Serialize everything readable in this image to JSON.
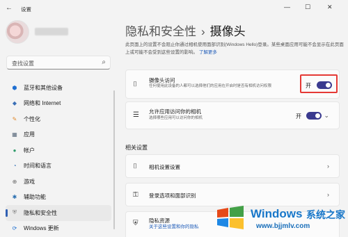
{
  "window": {
    "title": "设置",
    "back_icon": "back-arrow-icon",
    "controls": [
      "minimize-icon",
      "maximize-icon",
      "close-icon"
    ]
  },
  "sidebar": {
    "search_placeholder": "查找设置",
    "items": [
      {
        "label": "蓝牙和其他设备",
        "icon": "bluetooth-icon",
        "color": "#1f6fd1"
      },
      {
        "label": "网络和 Internet",
        "icon": "wifi-icon",
        "color": "#3b6fb6"
      },
      {
        "label": "个性化",
        "icon": "brush-icon",
        "color": "#e08a2e"
      },
      {
        "label": "应用",
        "icon": "apps-icon",
        "color": "#5b6b7d"
      },
      {
        "label": "帐户",
        "icon": "account-icon",
        "color": "#2e9b6a"
      },
      {
        "label": "时间和语言",
        "icon": "globe-clock-icon",
        "color": "#2f6fb3"
      },
      {
        "label": "游戏",
        "icon": "gamepad-icon",
        "color": "#6b6b6b"
      },
      {
        "label": "辅助功能",
        "icon": "accessibility-icon",
        "color": "#2a6fb0"
      },
      {
        "label": "隐私和安全性",
        "icon": "shield-icon",
        "color": "#7c7c7c",
        "active": true
      },
      {
        "label": "Windows 更新",
        "icon": "update-icon",
        "color": "#1f6fd1"
      }
    ]
  },
  "main": {
    "breadcrumb_parent": "隐私和安全性",
    "breadcrumb_sep": "›",
    "breadcrumb_current": "摄像头",
    "description": "此页面上的设置不会阻止你通过相机使用面部识别(Windows Hello)登录。某些桌面应用可能不会显示在此页面上或可能不会受到这些设置的影响。",
    "description_link": "了解更多",
    "camera_access": {
      "title": "摄像头访问",
      "subtitle": "任何使用此设备的人都可以选择他们的应用在开启时是否有相机访问权限",
      "toggle_label": "开",
      "toggle_on": true
    },
    "app_access": {
      "title": "允许应用访问你的相机",
      "subtitle": "选择哪些应用可以访问你的相机",
      "toggle_label": "开",
      "toggle_on": true
    },
    "related_title": "相关设置",
    "related": [
      {
        "label": "相机设置设置",
        "icon": "camera-icon"
      },
      {
        "label": "登录选项和面部识别",
        "icon": "key-icon"
      }
    ],
    "privacy_resources": {
      "title": "隐私资源",
      "link": "关于这些设置和你的隐私"
    }
  },
  "watermark": {
    "brand": "Windows",
    "brand2": "系统之家",
    "url": "www.bjjmlv.com"
  }
}
